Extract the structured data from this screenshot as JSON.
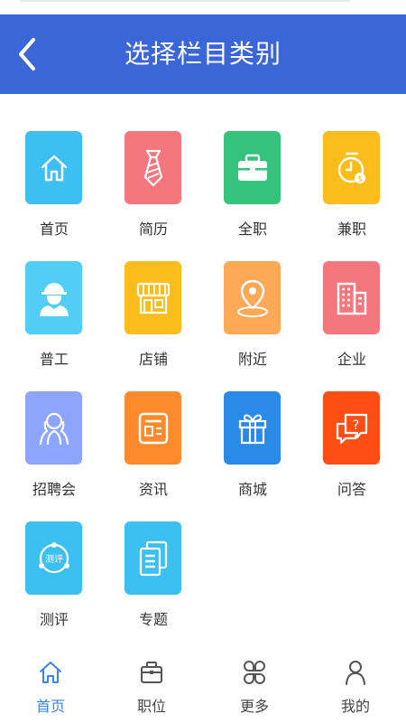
{
  "header": {
    "title": "选择栏目类别"
  },
  "colors": {
    "header_bg": "#3a66d8",
    "active_tab": "#3a86e8"
  },
  "categories": [
    {
      "label": "首页",
      "icon": "home-icon",
      "color": "#3cc0f2"
    },
    {
      "label": "简历",
      "icon": "tie-icon",
      "color": "#f5777e"
    },
    {
      "label": "全职",
      "icon": "briefcase-icon",
      "color": "#35c37b"
    },
    {
      "label": "兼职",
      "icon": "clock-icon",
      "color": "#fbbd1c"
    },
    {
      "label": "普工",
      "icon": "worker-icon",
      "color": "#52cdf5"
    },
    {
      "label": "店铺",
      "icon": "store-icon",
      "color": "#fbbd1c"
    },
    {
      "label": "附近",
      "icon": "location-icon",
      "color": "#fea958"
    },
    {
      "label": "企业",
      "icon": "building-icon",
      "color": "#f5777e"
    },
    {
      "label": "招聘会",
      "icon": "people-icon",
      "color": "#8ea5fd"
    },
    {
      "label": "资讯",
      "icon": "news-icon",
      "color": "#fe8a2e"
    },
    {
      "label": "商城",
      "icon": "gift-icon",
      "color": "#2a8ae8"
    },
    {
      "label": "问答",
      "icon": "qa-icon",
      "color": "#fe4e14"
    },
    {
      "label": "测评",
      "icon": "evaluation-icon",
      "color": "#3cc0f2"
    },
    {
      "label": "专题",
      "icon": "topic-icon",
      "color": "#3cc0f2"
    }
  ],
  "tabs": [
    {
      "label": "首页",
      "icon": "home-icon",
      "active": true
    },
    {
      "label": "职位",
      "icon": "briefcase-icon",
      "active": false
    },
    {
      "label": "更多",
      "icon": "clover-icon",
      "active": false
    },
    {
      "label": "我的",
      "icon": "user-icon",
      "active": false
    }
  ]
}
